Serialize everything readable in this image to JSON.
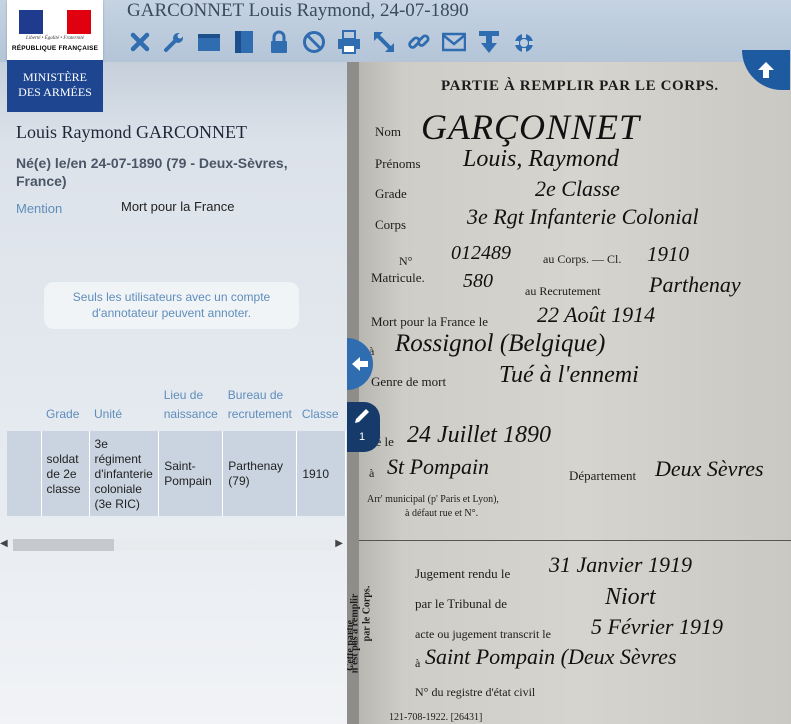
{
  "header": {
    "title": "GARCONNET Louis Raymond, 24-07-1890",
    "logo_devise": "Liberté • Égalité • Fraternité",
    "logo_rf": "RÉPUBLIQUE FRANÇAISE",
    "logo_ministry_line1": "MINISTÈRE",
    "logo_ministry_line2": "DES ARMÉES",
    "accent_color": "#2f6cb0"
  },
  "toolbar": {
    "icons": [
      "close-icon",
      "wrench-icon",
      "view-horizontal-icon",
      "view-vertical-icon",
      "lock-icon",
      "block-icon",
      "print-icon",
      "resize-icon",
      "link-icon",
      "mail-icon",
      "download-icon",
      "lifebuoy-icon"
    ]
  },
  "person": {
    "name": "Louis Raymond GARCONNET",
    "born": "Né(e) le/en 24-07-1890 (79 - Deux-Sèvres, France)",
    "mention_label": "Mention",
    "mention_value": "Mort pour la France"
  },
  "annotation_note": "Seuls les utilisateurs avec un compte d'annotateur peuvent annoter.",
  "table": {
    "headers": [
      "",
      "Grade",
      "Unité",
      "Lieu de naissance",
      "Bureau de recrutement",
      "Classe"
    ],
    "rows": [
      [
        "",
        "soldat de 2e classe",
        "3e régiment d'infanterie coloniale (3e RIC)",
        "Saint-Pompain",
        "Parthenay (79)",
        "1910"
      ]
    ]
  },
  "annotations": {
    "count": "1"
  },
  "document": {
    "header": "PARTIE À REMPLIR PAR LE CORPS.",
    "labels": {
      "nom": "Nom",
      "prenoms": "Prénoms",
      "grade": "Grade",
      "corps": "Corps",
      "no": "N°",
      "matricule": "Matricule.",
      "au_corps": "au Corps. — Cl.",
      "au_recrutement": "au Recrutement",
      "mort_pour": "Mort pour la France le",
      "a1": "à",
      "genre": "Genre de mort",
      "ne_le": "né le",
      "a2": "à",
      "departement": "Département",
      "arr1": "Arr' municipal (p' Paris et Lyon),",
      "arr2": "à défaut rue et N°.",
      "side1": "Cette partie",
      "side2": "n'est pas à remplir",
      "side3": "par le Corps.",
      "jugement": "Jugement rendu le",
      "tribunal": "par le Tribunal de",
      "transcrit": "acte ou jugement transcrit le",
      "a3": "à",
      "registre": "N° du registre d'état civil",
      "footer": "121-708-1922. [26431]"
    },
    "handwriting": {
      "nom": "GARÇONNET",
      "prenoms": "Louis, Raymond",
      "grade": "2e Classe",
      "corps": "3e Rgt Infanterie Colonial",
      "numero": "012489",
      "classe": "1910",
      "recrutement_no": "580",
      "recrutement": "Parthenay",
      "date_mort": "22 Août 1914",
      "lieu_mort": "Rossignol (Belgique)",
      "genre": "Tué à l'ennemi",
      "date_naissance": "24 Juillet 1890",
      "lieu_naissance": "St Pompain",
      "departement": "Deux Sèvres",
      "jugement": "31 Janvier 1919",
      "tribunal": "Niort",
      "transcrit": "5 Février 1919",
      "transcrit_lieu": "Saint Pompain (Deux Sèvres"
    }
  }
}
